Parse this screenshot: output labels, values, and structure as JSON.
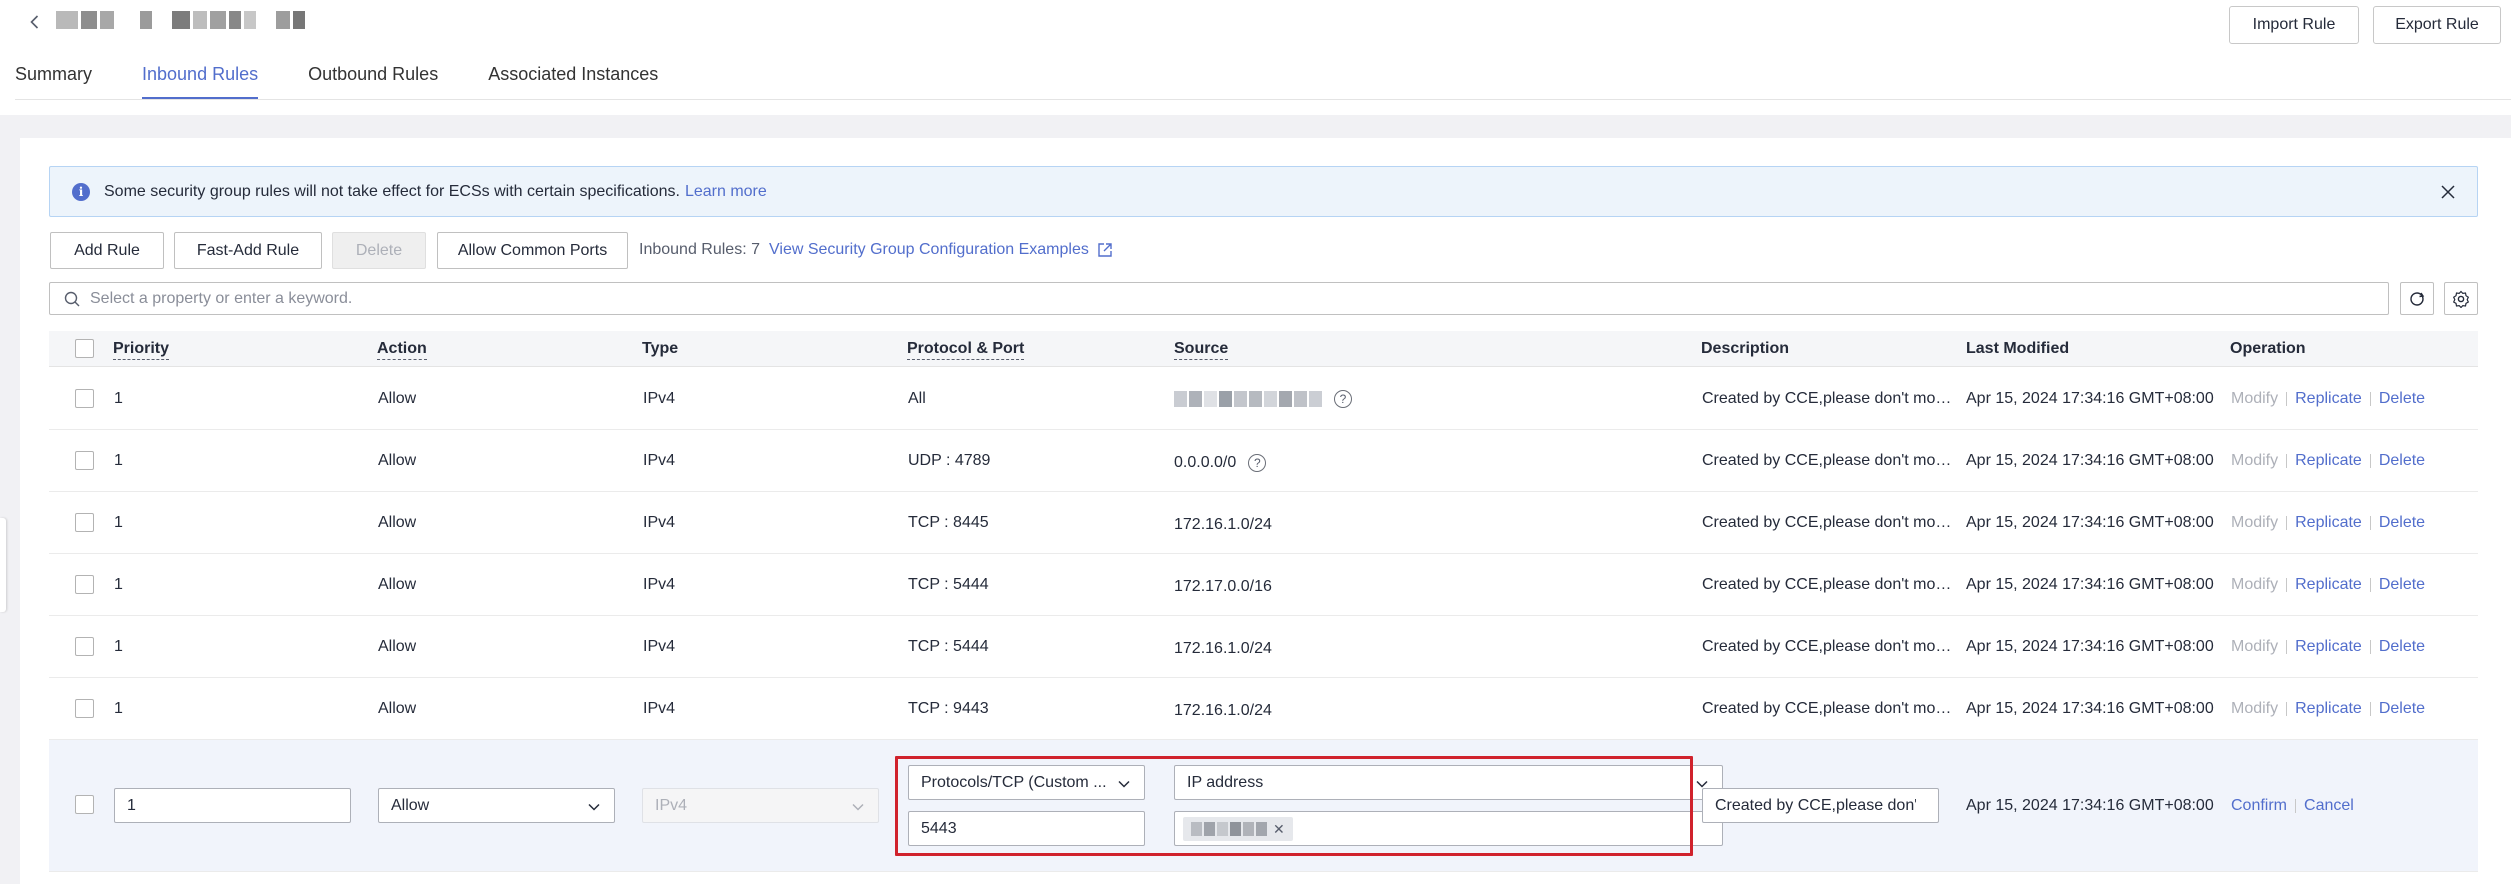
{
  "header": {
    "back_icon": "chevron-left-icon",
    "import_label": "Import Rule",
    "export_label": "Export Rule"
  },
  "tabs": [
    {
      "label": "Summary",
      "active": false
    },
    {
      "label": "Inbound Rules",
      "active": true
    },
    {
      "label": "Outbound Rules",
      "active": false
    },
    {
      "label": "Associated Instances",
      "active": false
    }
  ],
  "alert": {
    "icon": "info-icon",
    "text": "Some security group rules will not take effect for ECSs with certain specifications.",
    "link": "Learn more",
    "close_icon": "close-icon"
  },
  "toolbar": {
    "add_rule": "Add Rule",
    "fast_add_rule": "Fast-Add Rule",
    "delete": "Delete",
    "allow_common_ports": "Allow Common Ports",
    "rule_count": "Inbound Rules: 7",
    "examples_link": "View Security Group Configuration Examples"
  },
  "search": {
    "placeholder": "Select a property or enter a keyword."
  },
  "table": {
    "columns": {
      "priority": "Priority",
      "action": "Action",
      "type": "Type",
      "protocol_port": "Protocol & Port",
      "source": "Source",
      "description": "Description",
      "last_modified": "Last Modified",
      "operation": "Operation"
    },
    "rows": [
      {
        "priority": "1",
        "action": "Allow",
        "type": "IPv4",
        "protocol": "All",
        "source": "",
        "source_hidden": true,
        "description": "Created by CCE,please don't modify!",
        "last_modified": "Apr 15, 2024 17:34:16 GMT+08:00"
      },
      {
        "priority": "1",
        "action": "Allow",
        "type": "IPv4",
        "protocol": "UDP : 4789",
        "source": "0.0.0.0/0",
        "source_hidden": false,
        "description": "Created by CCE,please don't modify!",
        "last_modified": "Apr 15, 2024 17:34:16 GMT+08:00"
      },
      {
        "priority": "1",
        "action": "Allow",
        "type": "IPv4",
        "protocol": "TCP : 8445",
        "source": "172.16.1.0/24",
        "source_hidden": false,
        "description": "Created by CCE,please don't modify!",
        "last_modified": "Apr 15, 2024 17:34:16 GMT+08:00"
      },
      {
        "priority": "1",
        "action": "Allow",
        "type": "IPv4",
        "protocol": "TCP : 5444",
        "source": "172.17.0.0/16",
        "source_hidden": false,
        "description": "Created by CCE,please don't modify!",
        "last_modified": "Apr 15, 2024 17:34:16 GMT+08:00"
      },
      {
        "priority": "1",
        "action": "Allow",
        "type": "IPv4",
        "protocol": "TCP : 5444",
        "source": "172.16.1.0/24",
        "source_hidden": false,
        "description": "Created by CCE,please don't modify!",
        "last_modified": "Apr 15, 2024 17:34:16 GMT+08:00"
      },
      {
        "priority": "1",
        "action": "Allow",
        "type": "IPv4",
        "protocol": "TCP : 9443",
        "source": "172.16.1.0/24",
        "source_hidden": false,
        "description": "Created by CCE,please don't modify!",
        "last_modified": "Apr 15, 2024 17:34:16 GMT+08:00"
      }
    ],
    "operations": {
      "modify": "Modify",
      "replicate": "Replicate",
      "delete": "Delete"
    }
  },
  "edit_row": {
    "priority": "1",
    "action": "Allow",
    "type": "IPv4",
    "protocol_select": "Protocols/TCP (Custom ...",
    "port": "5443",
    "source_type": "IP address",
    "description": "Created by CCE,please don't m",
    "last_modified": "Apr 15, 2024 17:34:16 GMT+08:00",
    "confirm": "Confirm",
    "cancel": "Cancel"
  },
  "colors": {
    "accent": "#526ecc",
    "highlight_border": "#d0222c",
    "alert_bg": "#edf4fb"
  }
}
